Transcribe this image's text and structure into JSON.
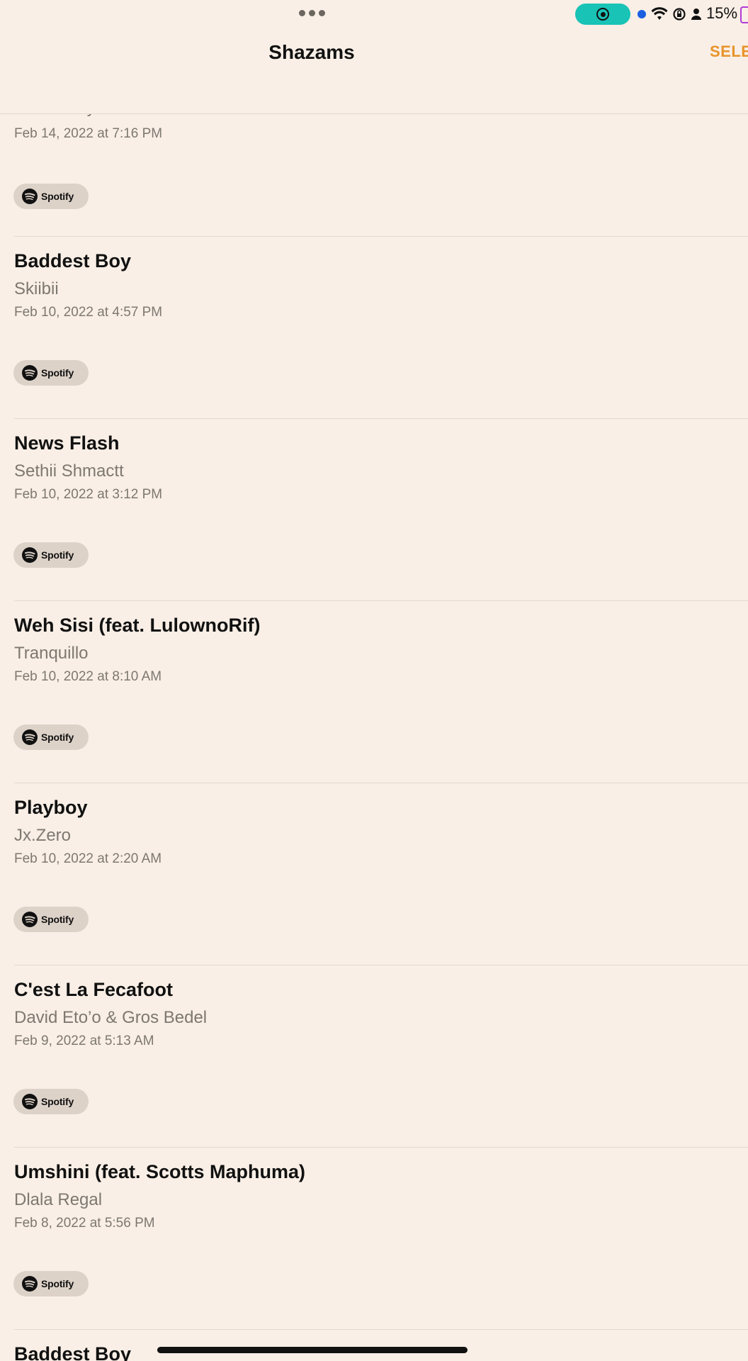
{
  "status_bar": {
    "battery_percent": "15%",
    "recording_color": "#19c3b6",
    "indicator_color": "#1a5fe0",
    "battery_color": "#b23ad6"
  },
  "nav": {
    "title": "Shazams",
    "select_label": "SELE"
  },
  "accent_color": "#e8932a",
  "shazams": [
    {
      "title": "",
      "artist": "Zinoleesky",
      "date": "Feb 14, 2022 at 7:16 PM",
      "service": "Spotify"
    },
    {
      "title": "Baddest Boy",
      "artist": "Skiibii",
      "date": "Feb 10, 2022 at 4:57 PM",
      "service": "Spotify"
    },
    {
      "title": "News Flash",
      "artist": "Sethii Shmactt",
      "date": "Feb 10, 2022 at 3:12 PM",
      "service": "Spotify"
    },
    {
      "title": "Weh Sisi (feat. LulownoRif)",
      "artist": "Tranquillo",
      "date": "Feb 10, 2022 at 8:10 AM",
      "service": "Spotify"
    },
    {
      "title": "Playboy",
      "artist": "Jx.Zero",
      "date": "Feb 10, 2022 at 2:20 AM",
      "service": "Spotify"
    },
    {
      "title": "C'est La Fecafoot",
      "artist": "David Eto’o & Gros Bedel",
      "date": "Feb 9, 2022 at 5:13 AM",
      "service": "Spotify"
    },
    {
      "title": "Umshini (feat. Scotts Maphuma)",
      "artist": "Dlala Regal",
      "date": "Feb 8, 2022 at 5:56 PM",
      "service": "Spotify"
    },
    {
      "title": "Baddest Boy",
      "artist": "",
      "date": "",
      "service": ""
    }
  ]
}
